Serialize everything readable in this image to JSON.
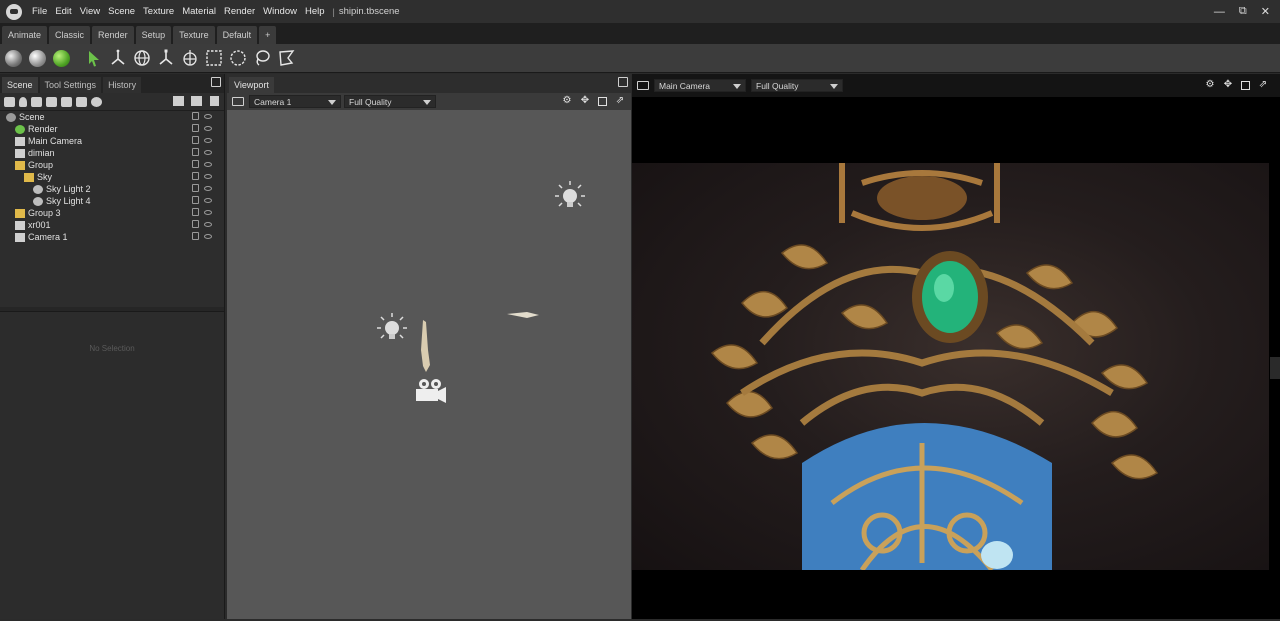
{
  "menu": {
    "items": [
      "File",
      "Edit",
      "View",
      "Scene",
      "Texture",
      "Material",
      "Render",
      "Window",
      "Help"
    ],
    "separator": "|",
    "document_title": "shipin.tbscene"
  },
  "window_controls": {
    "minimize": "—",
    "maximize": "⧉",
    "close": "✕"
  },
  "workspace_tabs": [
    "Animate",
    "Classic",
    "Render",
    "Setup",
    "Texture",
    "Default",
    "+"
  ],
  "left_panel": {
    "tabs": [
      "Scene",
      "Tool Settings",
      "History"
    ],
    "active_tab": "Scene",
    "tree": [
      {
        "label": "Scene",
        "depth": 0,
        "icon": "scene-icon"
      },
      {
        "label": "Render",
        "depth": 1,
        "icon": "render-gear-icon"
      },
      {
        "label": "Main Camera",
        "depth": 1,
        "icon": "camera-icon"
      },
      {
        "label": "dimian",
        "depth": 1,
        "icon": "mesh-icon"
      },
      {
        "label": "Group",
        "depth": 1,
        "icon": "folder-icon"
      },
      {
        "label": "Sky",
        "depth": 2,
        "icon": "sky-icon"
      },
      {
        "label": "Sky Light 2",
        "depth": 3,
        "icon": "light-icon"
      },
      {
        "label": "Sky Light 4",
        "depth": 3,
        "icon": "light-icon"
      },
      {
        "label": "Group 3",
        "depth": 1,
        "icon": "folder-icon"
      },
      {
        "label": "xr001",
        "depth": 1,
        "icon": "mesh-icon"
      },
      {
        "label": "Camera 1",
        "depth": 1,
        "icon": "camera-icon"
      }
    ],
    "properties_empty_text": "No Selection"
  },
  "viewport": {
    "tab_label": "Viewport",
    "camera_select": "Camera 1",
    "quality_select": "Full Quality"
  },
  "render_view": {
    "camera_select": "Main Camera",
    "quality_select": "Full Quality"
  },
  "colors": {
    "accent_green": "#6cc24a",
    "folder_yellow": "#e0b94a",
    "gem_green": "#23b37a",
    "enamel_blue": "#3f7fbf",
    "gold": "#b88a45"
  }
}
